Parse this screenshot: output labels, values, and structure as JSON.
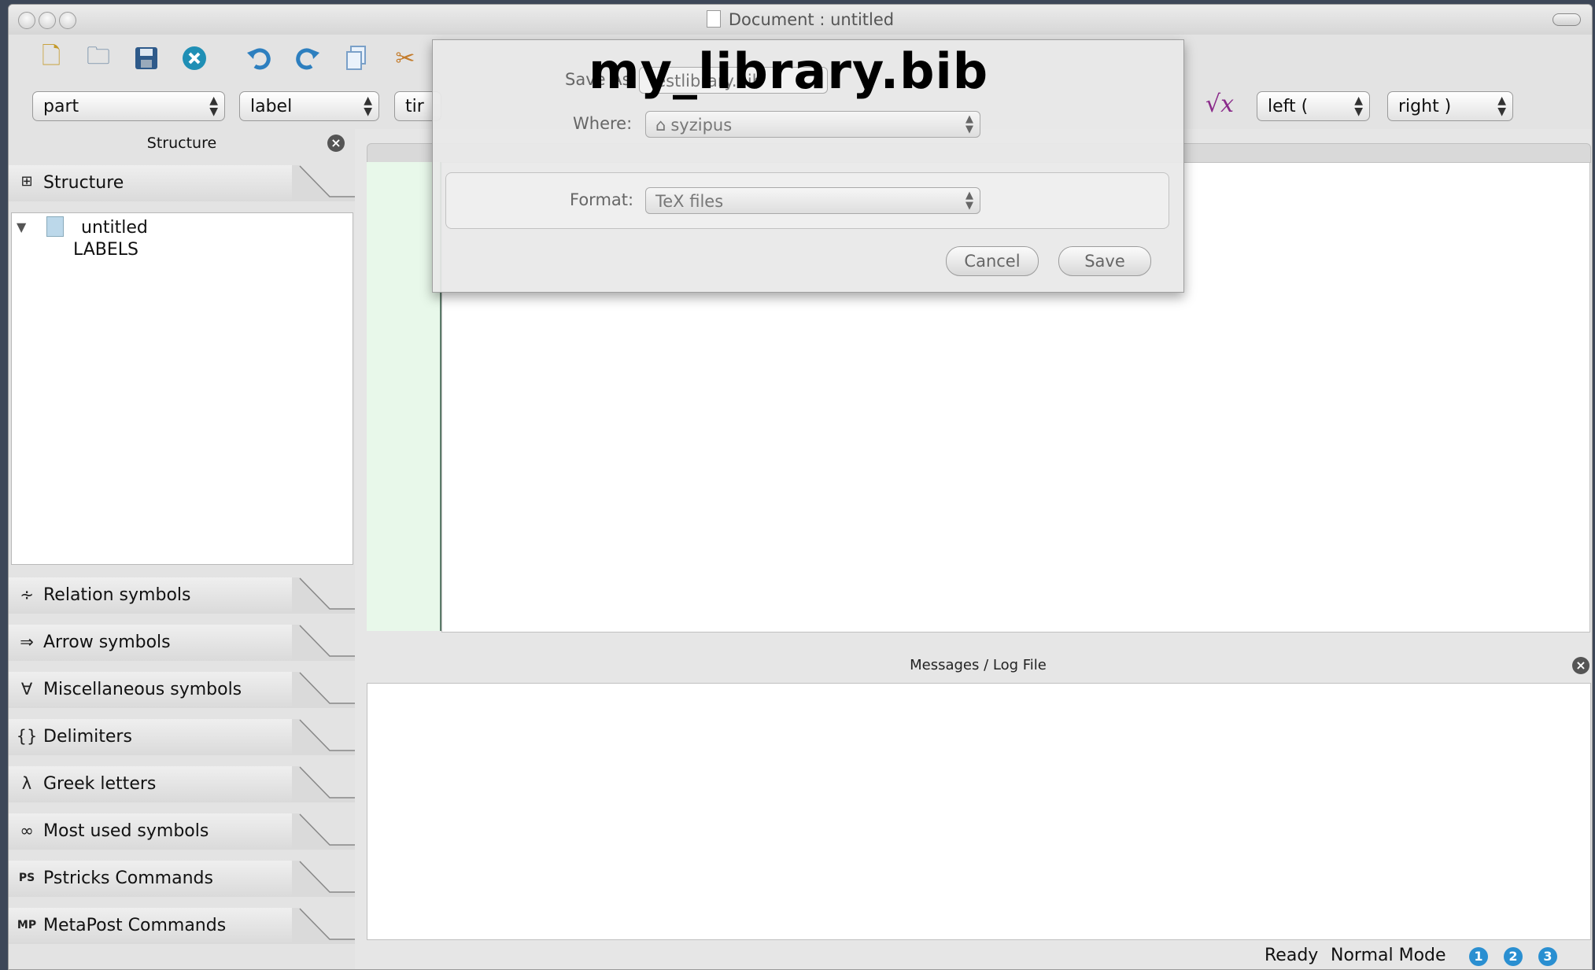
{
  "window": {
    "title": "Document : untitled"
  },
  "toolbar": {
    "combos": {
      "sectioning": "part",
      "reference": "label",
      "size": "tir",
      "left_delim": "left (",
      "right_delim": "right )"
    },
    "icons": [
      "new-file-icon",
      "open-folder-icon",
      "save-icon",
      "close-icon",
      "undo-icon",
      "redo-icon",
      "copy-icon",
      "cut-icon",
      "sqrt-icon"
    ],
    "sqrt_label": "√x"
  },
  "sidebar": {
    "header": "Structure",
    "structure_tab": "Structure",
    "tree": {
      "root": "untitled",
      "child": "LABELS"
    },
    "tabs": [
      {
        "label": "Relation symbols",
        "icon": "∻"
      },
      {
        "label": "Arrow symbols",
        "icon": "⇒"
      },
      {
        "label": "Miscellaneous symbols",
        "icon": "∀"
      },
      {
        "label": "Delimiters",
        "icon": "{}"
      },
      {
        "label": "Greek letters",
        "icon": "λ"
      },
      {
        "label": "Most used symbols",
        "icon": "∞"
      },
      {
        "label": "Pstricks Commands",
        "icon": "PS"
      },
      {
        "label": "MetaPost Commands",
        "icon": "MP"
      }
    ]
  },
  "messages": {
    "header": "Messages / Log File"
  },
  "status": {
    "state": "Ready",
    "mode": "Normal Mode",
    "buttons": [
      "1",
      "2",
      "3"
    ]
  },
  "save_dialog": {
    "save_as_label": "Save As:",
    "save_as_value": "testlibrary.bib",
    "where_label": "Where:",
    "where_value": "syzipus",
    "format_label": "Format:",
    "format_value": "TeX files",
    "cancel": "Cancel",
    "save": "Save"
  },
  "overlay_caption": "my_library.bib",
  "colors": {
    "accent_blue": "#2a8fd1",
    "gutter": "#e8f8ea"
  }
}
